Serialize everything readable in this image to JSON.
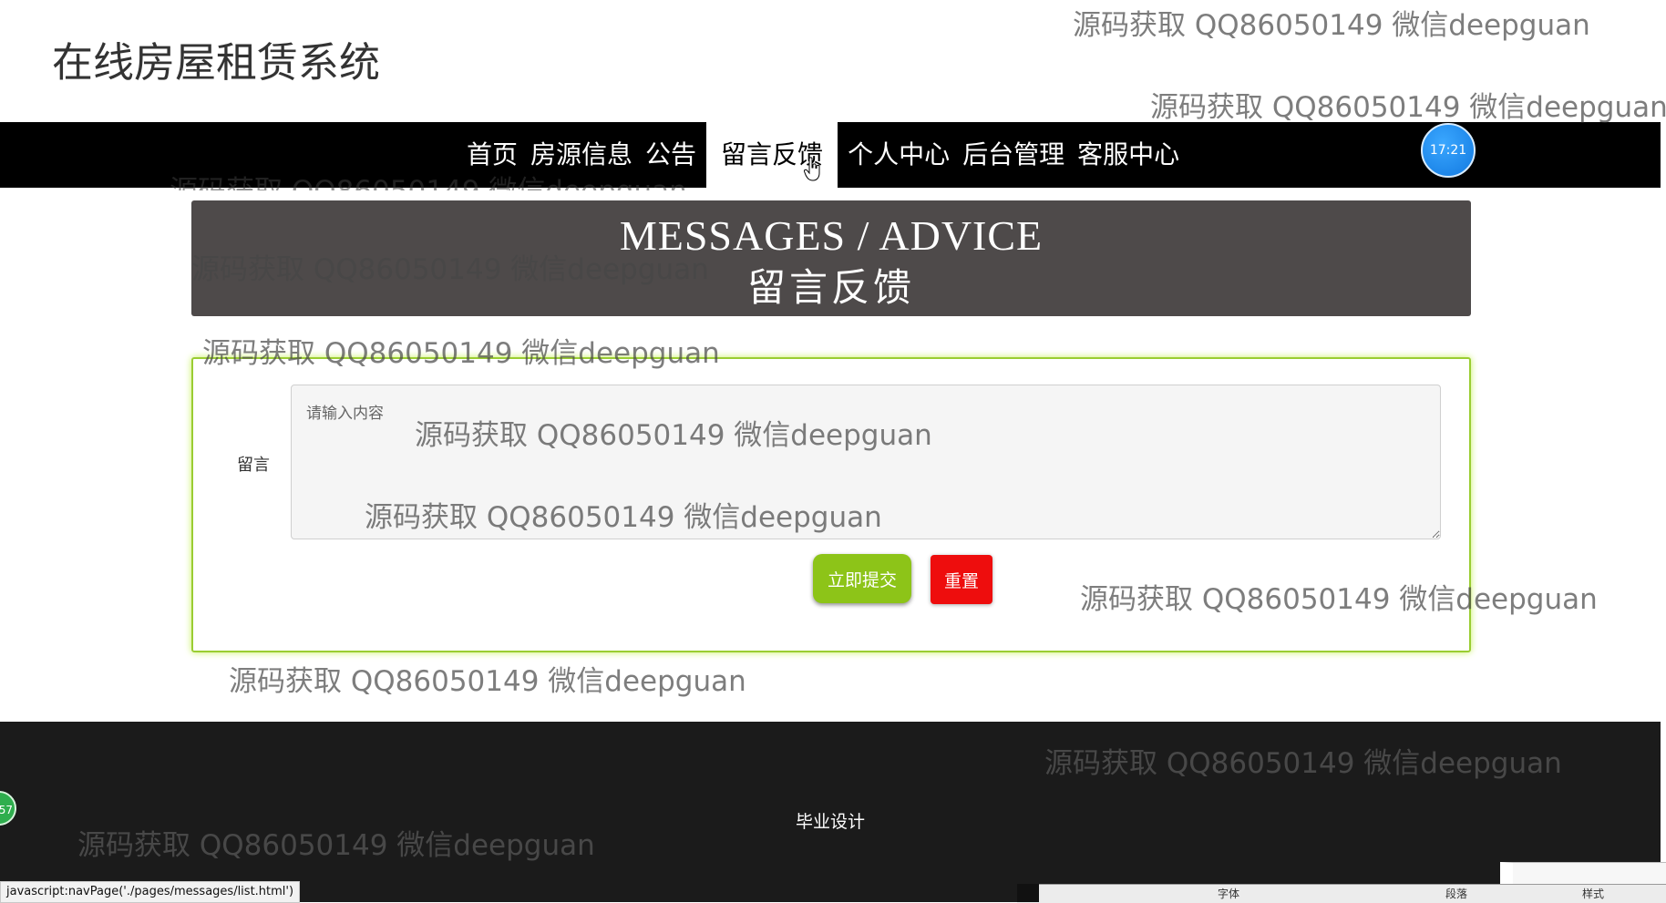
{
  "site": {
    "title": "在线房屋租赁系统"
  },
  "nav": {
    "items": [
      "首页",
      "房源信息",
      "公告",
      "留言反馈",
      "个人中心",
      "后台管理",
      "客服中心"
    ],
    "active": "留言反馈"
  },
  "clock": "17:21",
  "banner": {
    "english": "MESSAGES / ADVICE",
    "chinese": "留言反馈"
  },
  "form": {
    "label": "留言",
    "placeholder": "请输入内容",
    "submit_label": "立即提交",
    "reset_label": "重置",
    "border_color": "#9acd32"
  },
  "footer": {
    "text": "毕业设计"
  },
  "watermark": "源码获取 QQ86050149 微信deepguan",
  "status_bar": {
    "url": "javascript:navPage('./pages/messages/list.html')"
  },
  "side_bubble": "57",
  "taskbar": {
    "items": [
      "字体",
      "段落",
      "样式"
    ]
  },
  "colors": {
    "nav_bg": "#000000",
    "banner_bg": "#4e4a4a",
    "submit": "#8dc418",
    "reset": "#ee0d0d",
    "footer_bg": "#1b1b1b"
  }
}
